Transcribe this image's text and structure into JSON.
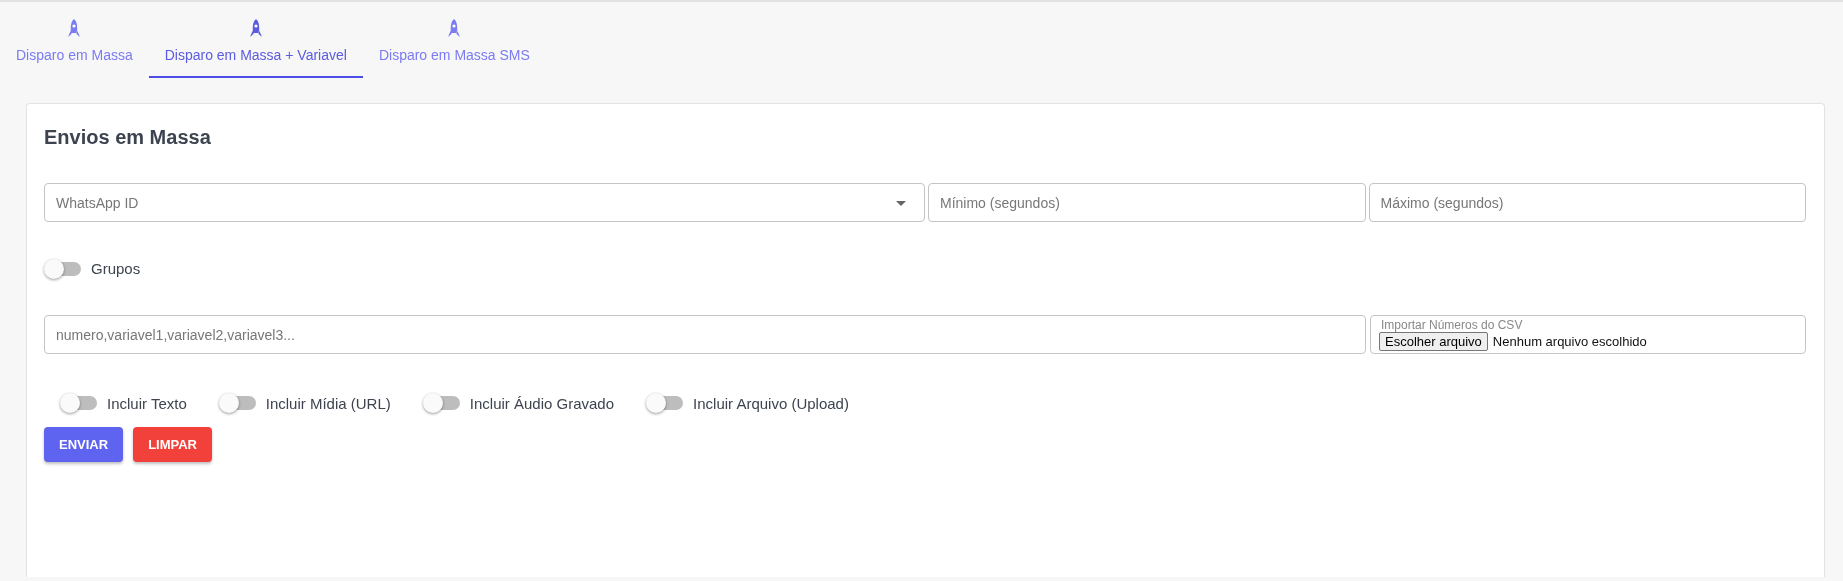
{
  "tabs": [
    {
      "label": "Disparo em Massa",
      "selected": false
    },
    {
      "label": "Disparo em Massa + Variavel",
      "selected": true
    },
    {
      "label": "Disparo em Massa SMS",
      "selected": false
    }
  ],
  "card": {
    "title": "Envios em Massa",
    "whatsapp_select": {
      "placeholder": "WhatsApp ID"
    },
    "min_field": {
      "placeholder": "Mínimo (segundos)"
    },
    "max_field": {
      "placeholder": "Máximo (segundos)"
    },
    "groups_toggle": {
      "label": "Grupos",
      "on": false
    },
    "numbers_field": {
      "placeholder": "numero,variavel1,variavel2,variavel3..."
    },
    "csv_import": {
      "label": "Importar Números do CSV",
      "button": "Escolher arquivo",
      "status": "Nenhum arquivo escolhido"
    },
    "options": [
      {
        "label": "Incluir Texto",
        "on": false
      },
      {
        "label": "Incluir Mídia (URL)",
        "on": false
      },
      {
        "label": "Incluir Áudio Gravado",
        "on": false
      },
      {
        "label": "Incluir Arquivo (Upload)",
        "on": false
      }
    ],
    "buttons": [
      {
        "label": "ENVIAR",
        "kind": "primary"
      },
      {
        "label": "LIMPAR",
        "kind": "danger"
      }
    ]
  }
}
